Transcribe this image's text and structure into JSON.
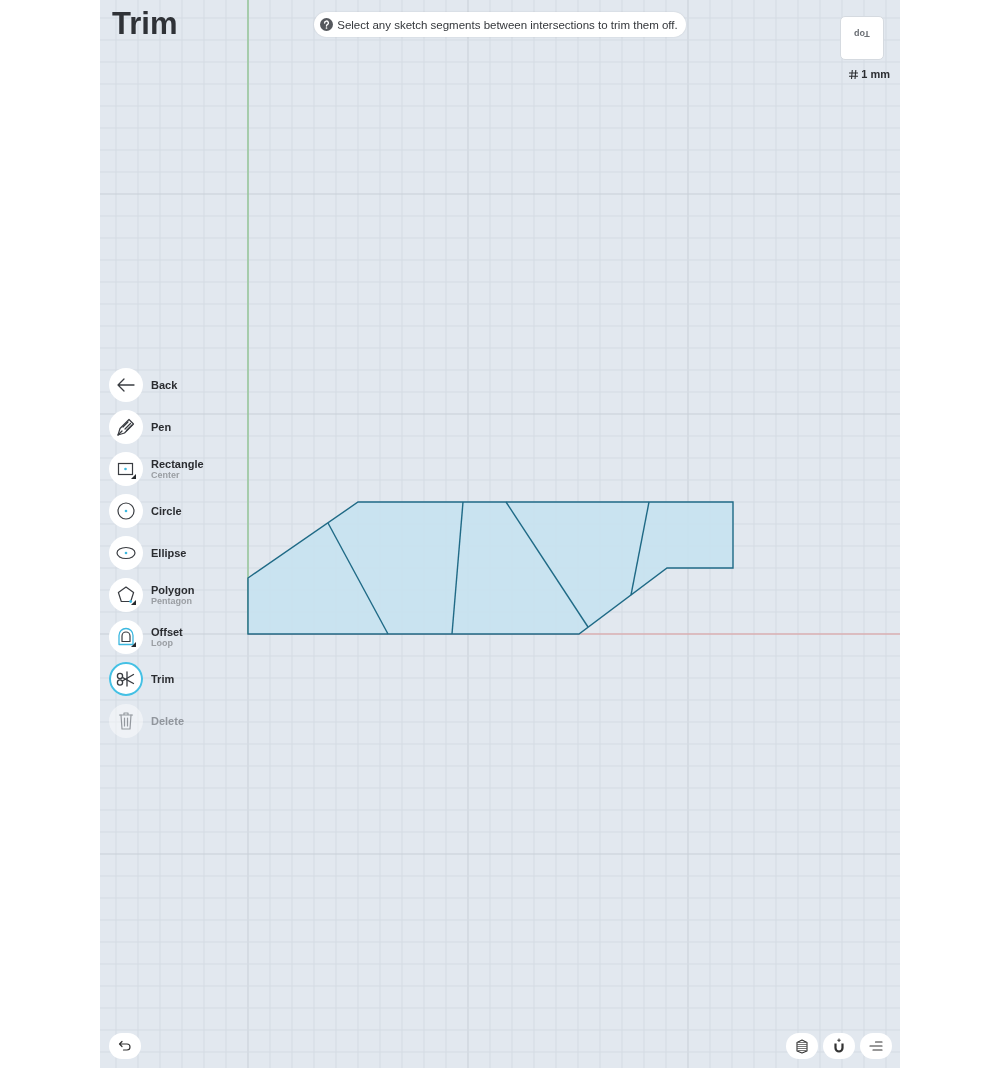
{
  "header": {
    "title": "Trim"
  },
  "hint": {
    "text": "Select any sketch segments between intersections to trim them off."
  },
  "view_cube": {
    "face": "Top"
  },
  "grid": {
    "scale": "1 mm"
  },
  "tools": [
    {
      "kind": "back",
      "label": "Back",
      "has_variants": false,
      "selected": false,
      "disabled": false
    },
    {
      "kind": "pen",
      "label": "Pen",
      "has_variants": false,
      "selected": false,
      "disabled": false
    },
    {
      "kind": "rectangle",
      "label": "Rectangle",
      "sublabel": "Center",
      "has_variants": true,
      "selected": false,
      "disabled": false
    },
    {
      "kind": "circle",
      "label": "Circle",
      "has_variants": false,
      "selected": false,
      "disabled": false
    },
    {
      "kind": "ellipse",
      "label": "Ellipse",
      "has_variants": false,
      "selected": false,
      "disabled": false
    },
    {
      "kind": "polygon",
      "label": "Polygon",
      "sublabel": "Pentagon",
      "has_variants": true,
      "selected": false,
      "disabled": false
    },
    {
      "kind": "offset",
      "label": "Offset",
      "sublabel": "Loop",
      "has_variants": true,
      "selected": false,
      "disabled": false
    },
    {
      "kind": "trim",
      "label": "Trim",
      "has_variants": false,
      "selected": true,
      "disabled": false
    },
    {
      "kind": "delete",
      "label": "Delete",
      "has_variants": false,
      "selected": false,
      "disabled": true
    }
  ]
}
